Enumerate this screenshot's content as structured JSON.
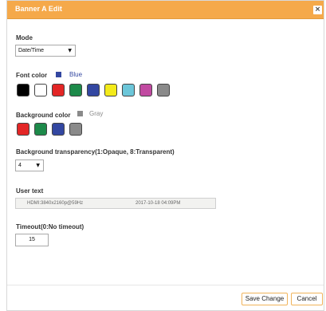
{
  "dialog": {
    "title": "Banner A Edit",
    "close_glyph": "×"
  },
  "mode": {
    "label": "Mode",
    "value": "Date/Time"
  },
  "font_color": {
    "label": "Font color",
    "selected_name": "Blue",
    "selected_color": "#3347a1",
    "swatches": [
      {
        "name": "black",
        "color": "#000000"
      },
      {
        "name": "white",
        "color": "#ffffff"
      },
      {
        "name": "red",
        "color": "#e32626"
      },
      {
        "name": "green",
        "color": "#1d8a4a"
      },
      {
        "name": "blue",
        "color": "#3347a1"
      },
      {
        "name": "yellow",
        "color": "#f3ea1a"
      },
      {
        "name": "cyan",
        "color": "#6cc6d9"
      },
      {
        "name": "magenta",
        "color": "#c14aa1"
      },
      {
        "name": "gray",
        "color": "#8a8a8a"
      }
    ]
  },
  "background_color": {
    "label": "Background color",
    "selected_name": "Gray",
    "selected_color": "#8a8a8a",
    "swatches": [
      {
        "name": "red",
        "color": "#e32626"
      },
      {
        "name": "green",
        "color": "#1d8a4a"
      },
      {
        "name": "blue",
        "color": "#3347a1"
      },
      {
        "name": "gray",
        "color": "#8a8a8a"
      }
    ]
  },
  "transparency": {
    "label": "Background transparency(1:Opaque, 8:Transparent)",
    "value": "4"
  },
  "user_text": {
    "label": "User text",
    "left": "HDMI:3840x2160p@59Hz",
    "right": "2017-10-18 04:09PM"
  },
  "timeout": {
    "label": "Timeout(0:No timeout)",
    "value": "15"
  },
  "buttons": {
    "save": "Save Change",
    "cancel": "Cancel"
  },
  "select_arrow": "▼"
}
